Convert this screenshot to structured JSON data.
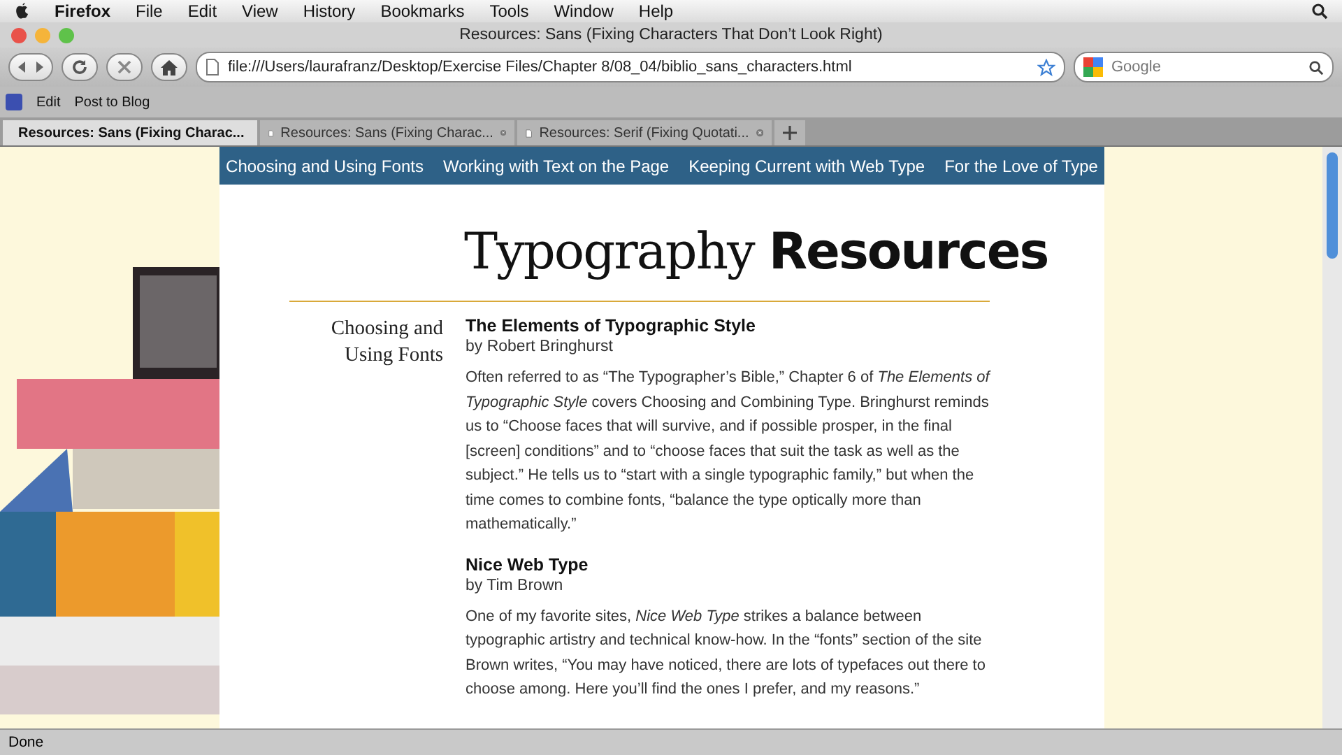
{
  "menu_bar": {
    "app": "Firefox",
    "items": [
      "File",
      "Edit",
      "View",
      "History",
      "Bookmarks",
      "Tools",
      "Window",
      "Help"
    ]
  },
  "window": {
    "title": "Resources: Sans (Fixing Characters That Don’t Look Right)"
  },
  "toolbar": {
    "url": "file:///Users/laurafranz/Desktop/Exercise Files/Chapter 8/08_04/biblio_sans_characters.html",
    "search": {
      "placeholder": "Google"
    }
  },
  "bookmarks": [
    "Edit",
    "Post to Blog"
  ],
  "tabs": [
    {
      "label": "Resources: Sans (Fixing Charac...",
      "selected": true
    },
    {
      "label": "Resources: Sans (Fixing Charac...",
      "selected": false
    },
    {
      "label": "Resources: Serif (Fixing Quotati...",
      "selected": false
    }
  ],
  "page": {
    "nav": [
      "Choosing and Using Fonts",
      "Working with Text on the Page",
      "Keeping Current with Web Type",
      "For the Love of Type"
    ],
    "title_light": "Typography",
    "title_bold": "Resources",
    "section": "Choosing and Using Fonts",
    "entries": [
      {
        "title": "The Elements of Typographic Style",
        "author": "by Robert Bringhurst",
        "text": "Often referred to as “The Typographer’s Bible,” Chapter 6 of *The Elements of Typographic Style* covers Choosing and Combining Type. Bringhurst reminds us to “Choose faces that will survive, and if possible prosper, in the final [screen] conditions” and to “choose faces that suit the task as well as the subject.” He tells us to “start with a single typographic family,” but when the time comes to combine fonts, “balance the type optically more than mathematically.”"
      },
      {
        "title": "Nice Web Type",
        "author": "by Tim Brown",
        "text": "One of my favorite sites, *Nice Web Type* strikes a balance between typographic artistry and technical know-how. In the “fonts” section of the site Brown writes, “You may have noticed, there are lots of typefaces out there to choose among. Here you’ll find the ones I prefer, and my reasons.”"
      }
    ]
  },
  "status_bar": {
    "text": "Done"
  }
}
